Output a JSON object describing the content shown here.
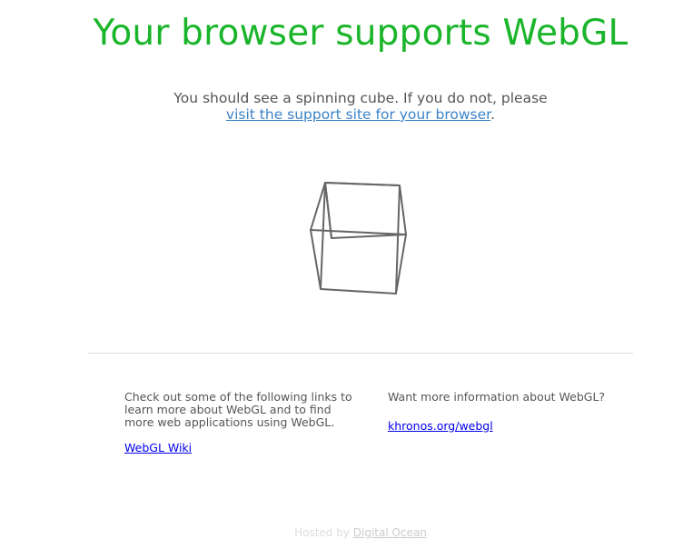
{
  "header": {
    "title": "Your browser supports WebGL"
  },
  "intro": {
    "text_before": "You should see a spinning cube. If you do not, please",
    "link_text": "visit the support site for your browser",
    "text_after": "."
  },
  "cube": {
    "icon": "wireframe-cube",
    "stroke_color": "#666666"
  },
  "info": {
    "left": {
      "text": "Check out some of the following links to learn more about WebGL and to find more web applications using WebGL.",
      "link": "WebGL Wiki"
    },
    "right": {
      "text": "Want more information about WebGL?",
      "link": "khronos.org/webgl"
    }
  },
  "footer": {
    "prefix": "Hosted by",
    "link": "Digital Ocean"
  },
  "colors": {
    "title": "#1ab52a",
    "link": "#3b83c8",
    "text": "#555555"
  }
}
